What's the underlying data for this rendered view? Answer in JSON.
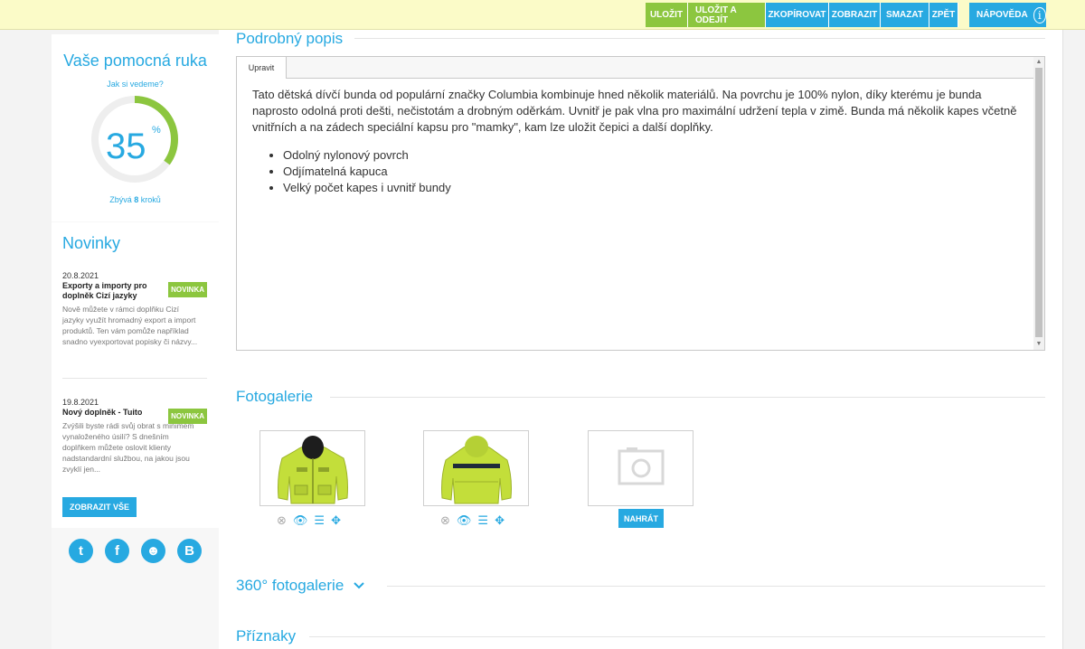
{
  "toolbar": {
    "save": "ULOŽIT",
    "save_exit": "ULOŽIT A ODEJÍT",
    "copy": "ZKOPÍROVAT",
    "view": "ZOBRAZIT",
    "delete": "SMAZAT",
    "back": "ZPĚT",
    "help": "NÁPOVĚDA",
    "colors": {
      "green": "#8cc63f",
      "blue": "#27a9e1"
    }
  },
  "helper": {
    "title": "Vaše pomocná ruka",
    "link": "Jak si vedeme?",
    "progress_value": "35",
    "progress_unit": "%",
    "progress_fraction": 0.35,
    "remaining_prefix": "Zbývá ",
    "remaining_count": "8",
    "remaining_suffix": " kroků"
  },
  "news": {
    "title": "Novinky",
    "items": [
      {
        "date": "20.8.2021",
        "headline": "Exporty a importy pro doplněk Cizí jazyky",
        "text": "Nově můžete v rámci doplňku Cizí jazyky využít hromadný export a import produktů. Ten vám pomůže například snadno vyexportovat popisky či názvy...",
        "badge": "NOVINKA"
      },
      {
        "date": "19.8.2021",
        "headline": "Nový doplněk - Tuito",
        "text": "Zvýšili byste rádi svůj obrat s minimem vynaloženého úsilí? S dnešním doplňkem můžete oslovit klienty nadstandardní službou, na jakou jsou zvyklí jen...",
        "badge": "NOVINKA"
      }
    ],
    "show_all": "ZOBRAZIT VŠE"
  },
  "social": {
    "icons": [
      "twitter-icon",
      "facebook-icon",
      "community-icon",
      "blogger-icon"
    ],
    "glyphs": [
      "t",
      "f",
      "☻",
      "B"
    ]
  },
  "description": {
    "title": "Podrobný popis",
    "tab": "Upravit",
    "paragraph": "Tato dětská dívčí bunda od populární značky Columbia kombinuje hned několik materiálů. Na povrchu je 100% nylon, díky kterému je bunda naprosto odolná proti dešti, nečistotám a drobným oděrkám. Uvnitř je pak vlna pro maximální udržení tepla v zimě. Bunda má několik kapes včetně vnitřních a na zádech speciální kapsu pro \"mamky\", kam lze uložit čepici a další doplňky.",
    "bullets": [
      "Odolný nylonový povrch",
      "Odjímatelná kapuca",
      "Velký počet kapes i uvnitř bundy"
    ]
  },
  "gallery": {
    "title": "Fotogalerie",
    "upload": "NAHRÁT"
  },
  "gallery360": {
    "title": "360° fotogalerie"
  },
  "flags": {
    "title": "Příznaky"
  }
}
